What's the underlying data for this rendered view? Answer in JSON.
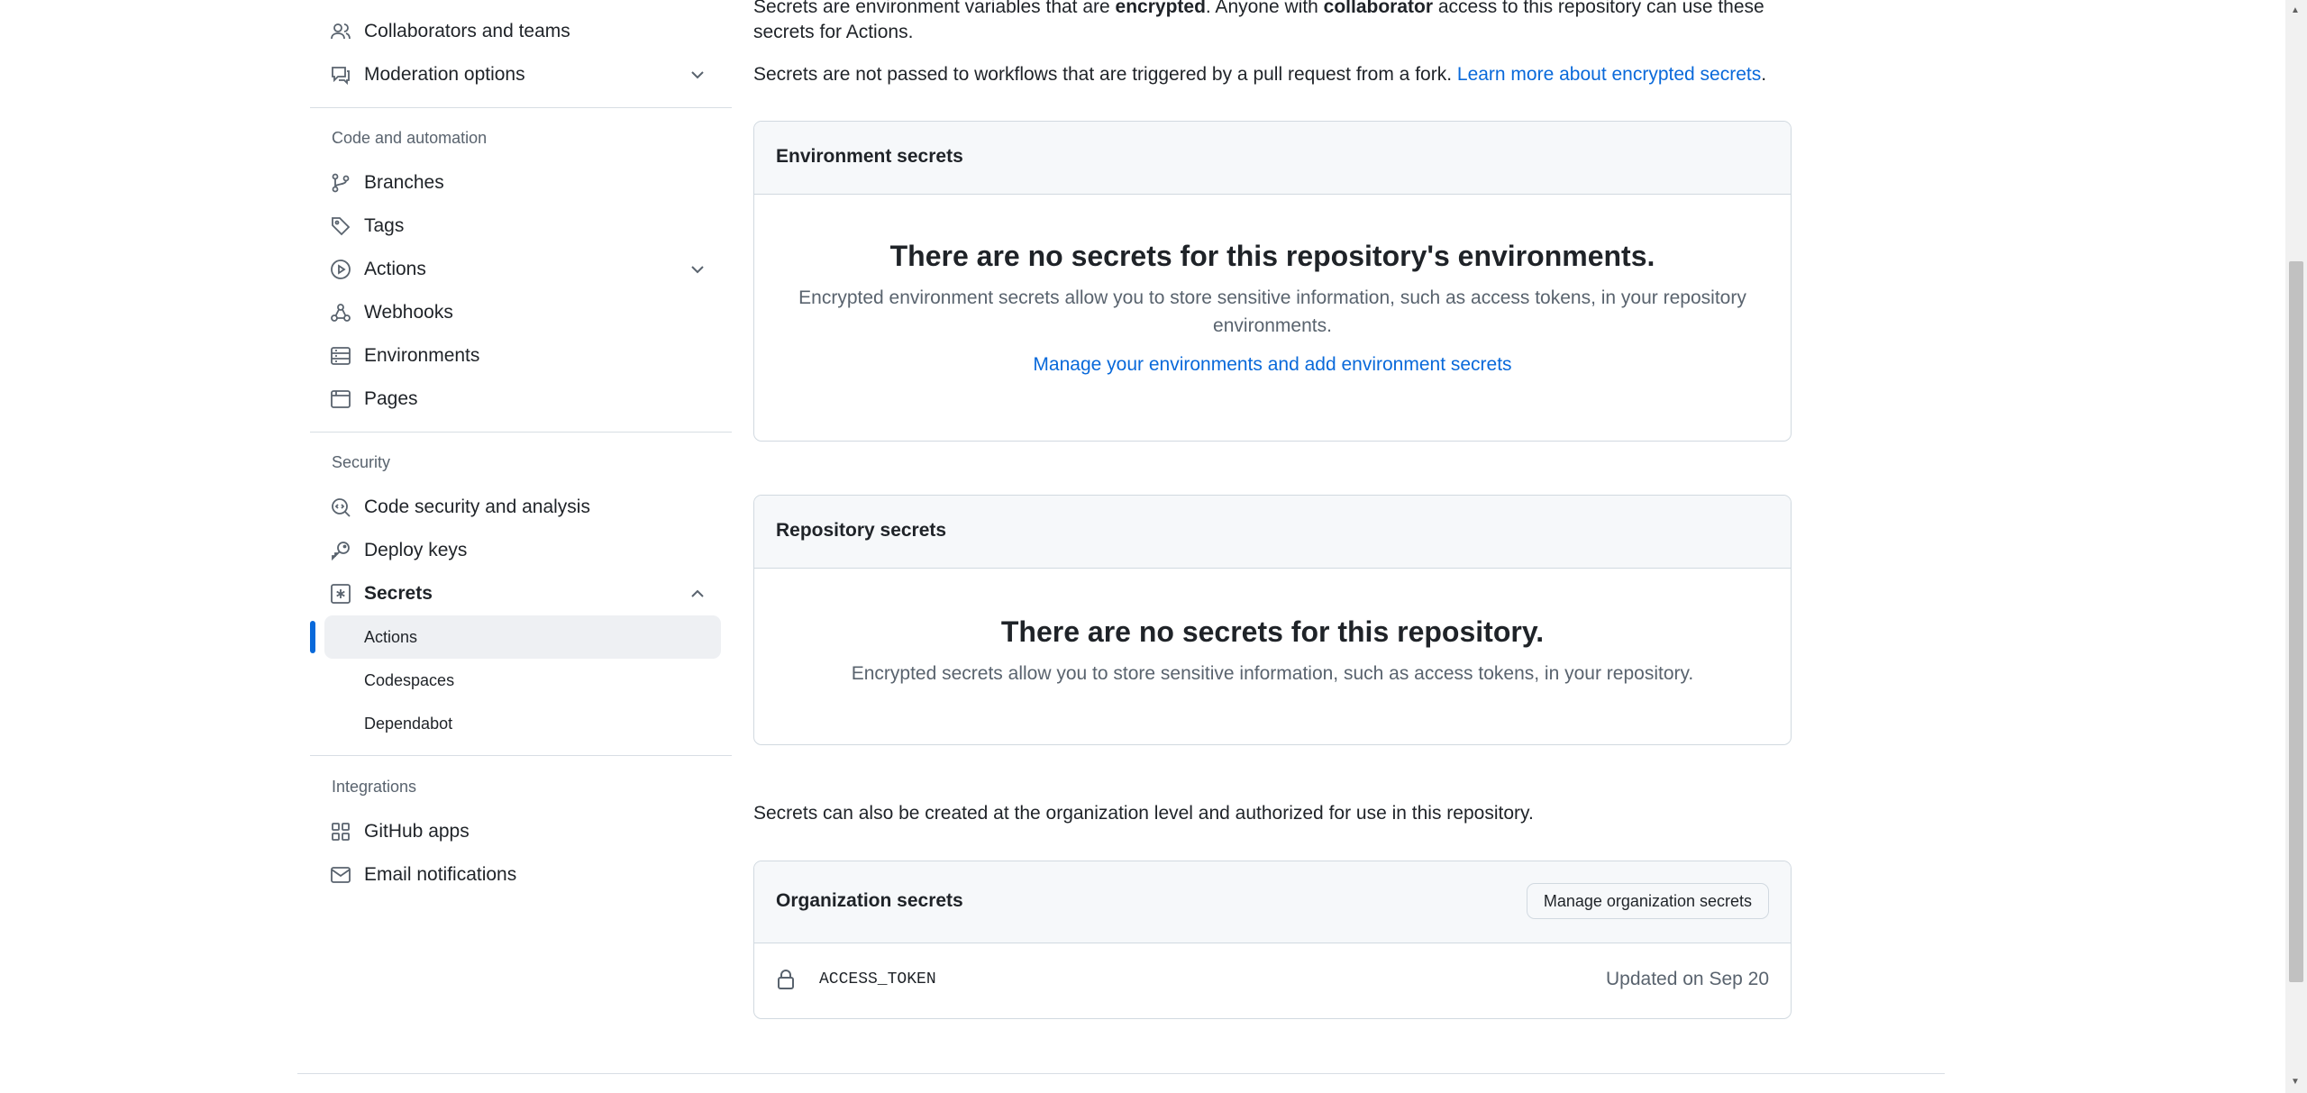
{
  "sidebar": {
    "items": [
      {
        "label": "Collaborators and teams"
      },
      {
        "label": "Moderation options"
      },
      {
        "label": "Branches"
      },
      {
        "label": "Tags"
      },
      {
        "label": "Actions"
      },
      {
        "label": "Webhooks"
      },
      {
        "label": "Environments"
      },
      {
        "label": "Pages"
      },
      {
        "label": "Code security and analysis"
      },
      {
        "label": "Deploy keys"
      },
      {
        "label": "Secrets"
      },
      {
        "label": "GitHub apps"
      },
      {
        "label": "Email notifications"
      }
    ],
    "secrets_sub": [
      {
        "label": "Actions",
        "active": true
      },
      {
        "label": "Codespaces"
      },
      {
        "label": "Dependabot"
      }
    ],
    "groups": {
      "code_automation": "Code and automation",
      "security": "Security",
      "integrations": "Integrations"
    }
  },
  "main": {
    "intro_part1": "Secrets are environment variables that are ",
    "intro_bold1": "encrypted",
    "intro_part2": ". Anyone with ",
    "intro_bold2": "collaborator",
    "intro_part3": " access to this repository can use these",
    "intro_line2": "secrets for Actions.",
    "fork_note": "Secrets are not passed to workflows that are triggered by a pull request from a fork. ",
    "learn_more": "Learn more about encrypted secrets",
    "env_secrets": {
      "title": "Environment secrets",
      "blank_title": "There are no secrets for this repository's environments.",
      "blank_desc_1": "Encrypted environment secrets allow you to store sensitive information, such as access tokens, in your repository",
      "blank_desc_2": "environments.",
      "link": "Manage your environments and add environment secrets"
    },
    "repo_secrets": {
      "title": "Repository secrets",
      "blank_title": "There are no secrets for this repository.",
      "blank_desc": "Encrypted secrets allow you to store sensitive information, such as access tokens, in your repository."
    },
    "org_note": "Secrets can also be created at the organization level and authorized for use in this repository.",
    "org_secrets": {
      "title": "Organization secrets",
      "manage_button": "Manage organization secrets",
      "rows": [
        {
          "name": "ACCESS_TOKEN",
          "updated": "Updated on Sep 20"
        }
      ]
    }
  },
  "colors": {
    "accent": "#0969da",
    "text": "#1f2328",
    "muted": "#59636e",
    "border": "#d1d9e0",
    "header_bg": "#f6f8fa"
  }
}
